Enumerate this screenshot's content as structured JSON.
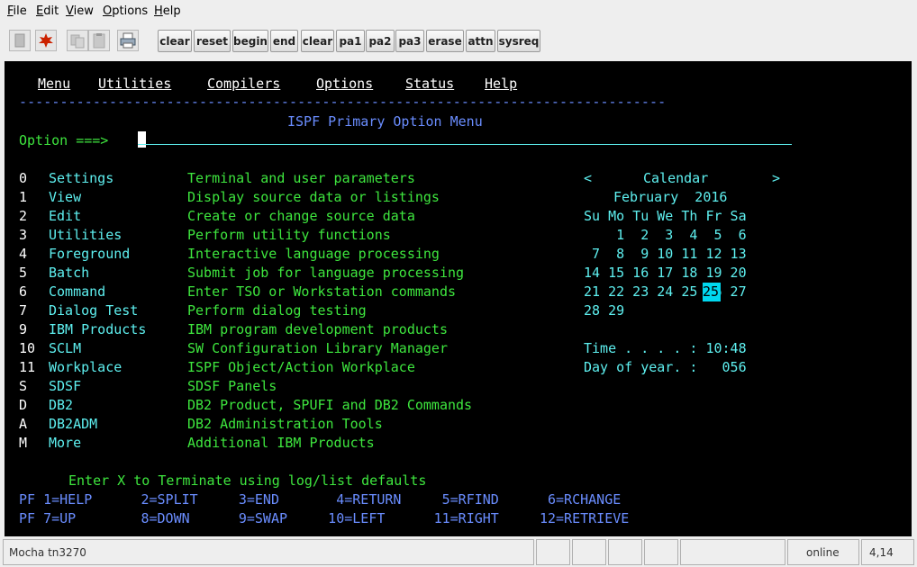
{
  "menubar": {
    "items": [
      "File",
      "Edit",
      "View",
      "Options",
      "Help"
    ]
  },
  "toolbar": {
    "icons": [
      "disconnect-icon",
      "connect-icon",
      "copy-icon",
      "paste-icon",
      "print-icon"
    ],
    "keys": [
      "clear",
      "reset",
      "begin",
      "end",
      "clear",
      "pa1",
      "pa2",
      "pa3",
      "erase",
      "attn",
      "sysreq"
    ]
  },
  "terminal": {
    "action_bar": [
      "Menu",
      "Utilities",
      "Compilers",
      "Options",
      "Status",
      "Help"
    ],
    "separator": "-------------------------------------------------------------------------------",
    "title": "ISPF Primary Option Menu",
    "option_label": "Option ===>",
    "options": [
      {
        "key": "0",
        "name": "Settings",
        "desc": "Terminal and user parameters"
      },
      {
        "key": "1",
        "name": "View",
        "desc": "Display source data or listings"
      },
      {
        "key": "2",
        "name": "Edit",
        "desc": "Create or change source data"
      },
      {
        "key": "3",
        "name": "Utilities",
        "desc": "Perform utility functions"
      },
      {
        "key": "4",
        "name": "Foreground",
        "desc": "Interactive language processing"
      },
      {
        "key": "5",
        "name": "Batch",
        "desc": "Submit job for language processing"
      },
      {
        "key": "6",
        "name": "Command",
        "desc": "Enter TSO or Workstation commands"
      },
      {
        "key": "7",
        "name": "Dialog Test",
        "desc": "Perform dialog testing"
      },
      {
        "key": "9",
        "name": "IBM Products",
        "desc": "IBM program development products"
      },
      {
        "key": "10",
        "name": "SCLM",
        "desc": "SW Configuration Library Manager"
      },
      {
        "key": "11",
        "name": "Workplace",
        "desc": "ISPF Object/Action Workplace"
      },
      {
        "key": "S",
        "name": "SDSF",
        "desc": "SDSF Panels"
      },
      {
        "key": "D",
        "name": "DB2",
        "desc": "DB2 Product, SPUFI and DB2 Commands"
      },
      {
        "key": "A",
        "name": "DB2ADM",
        "desc": "DB2 Administration Tools"
      },
      {
        "key": "M",
        "name": "More",
        "desc": "Additional IBM Products"
      }
    ],
    "calendar": {
      "prev": "<",
      "title": "Calendar",
      "next": ">",
      "month_year": "February  2016",
      "weekdays": "Su Mo Tu We Th Fr Sa",
      "weeks": [
        "    1  2  3  4  5  6",
        " 7  8  9 10 11 12 13",
        "14 15 16 17 18 19 20",
        "21 22 23 24 25 26 27",
        "28 29"
      ],
      "today": "25",
      "time_line": "Time . . . . : 10:48",
      "day_line": "Day of year. :   056"
    },
    "footer": "Enter X to Terminate using log/list defaults",
    "pf_row1": "PF 1=HELP      2=SPLIT     3=END       4=RETURN     5=RFIND      6=RCHANGE",
    "pf_row2": "PF 7=UP        8=DOWN      9=SWAP     10=LEFT      11=RIGHT     12=RETRIEVE"
  },
  "statusbar": {
    "app": "Mocha tn3270",
    "state": "online",
    "cursor": "4,14"
  }
}
